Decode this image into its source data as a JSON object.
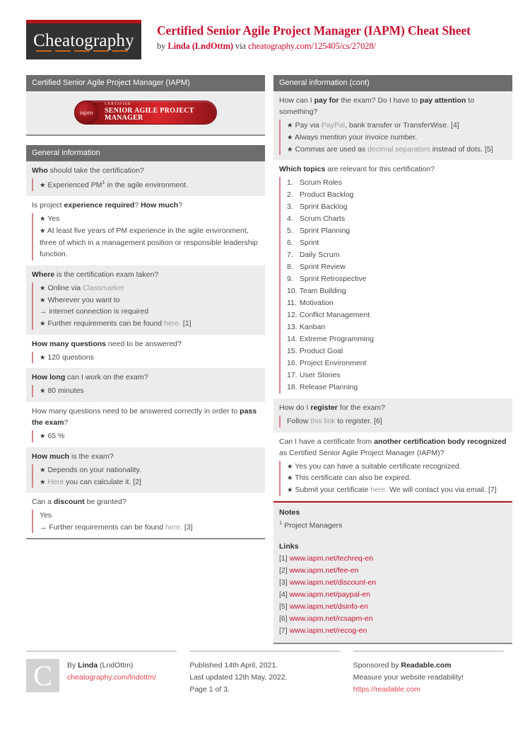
{
  "header": {
    "logo_text": "Cheatography",
    "title": "Certified Senior Agile Project Manager (IAPM) Cheat Sheet",
    "by_prefix": "by ",
    "author": "Linda (LndOttm)",
    "via": " via ",
    "source_url": "cheatography.com/125405/cs/27028/"
  },
  "left_column": {
    "badge_block": {
      "head": "Certified Senior Agile Project Manager (IAPM)",
      "badge": {
        "seal_text": "iapm",
        "small_line": "CERTIFIED",
        "large_line": "SENIOR AGILE PROJECT MANAGER"
      }
    },
    "general_info": {
      "head": "General information",
      "rows": [
        {
          "q_parts": [
            {
              "t": "Who",
              "b": true
            },
            {
              "t": " should take the certification?",
              "b": false
            }
          ],
          "answers": [
            {
              "marker": "star",
              "parts": [
                {
                  "t": "Experienced PM"
                },
                {
                  "t": "1",
                  "sup": true
                },
                {
                  "t": " in the agile environment."
                }
              ]
            }
          ]
        },
        {
          "q_parts": [
            {
              "t": "Is project ",
              "b": false
            },
            {
              "t": "experience required",
              "b": true
            },
            {
              "t": "? ",
              "b": false
            },
            {
              "t": "How much",
              "b": true
            },
            {
              "t": "?",
              "b": false
            }
          ],
          "answers": [
            {
              "marker": "star",
              "parts": [
                {
                  "t": "Yes"
                }
              ]
            },
            {
              "marker": "star",
              "parts": [
                {
                  "t": "At least five years of PM experience in the agile environment, three of which in a management position or responsible leadership function."
                }
              ]
            }
          ]
        },
        {
          "q_parts": [
            {
              "t": "Where",
              "b": true
            },
            {
              "t": " is the certification exam taken?",
              "b": false
            }
          ],
          "answers": [
            {
              "marker": "star",
              "parts": [
                {
                  "t": "Online via "
                },
                {
                  "t": "Classmarker",
                  "mut": true
                }
              ]
            },
            {
              "marker": "star",
              "parts": [
                {
                  "t": "Wherever you want to"
                }
              ]
            },
            {
              "marker": "arrow",
              "parts": [
                {
                  "t": "internet connection is required"
                }
              ]
            },
            {
              "marker": "star",
              "parts": [
                {
                  "t": "Further requirements can be found "
                },
                {
                  "t": "here.",
                  "mut": true
                },
                {
                  "t": " [1]"
                }
              ]
            }
          ]
        },
        {
          "q_parts": [
            {
              "t": "How many questions",
              "b": true
            },
            {
              "t": " need to be answered?",
              "b": false
            }
          ],
          "answers": [
            {
              "marker": "star",
              "parts": [
                {
                  "t": "120 questions"
                }
              ]
            }
          ]
        },
        {
          "q_parts": [
            {
              "t": "How long",
              "b": true
            },
            {
              "t": " can I work on the exam?",
              "b": false
            }
          ],
          "answers": [
            {
              "marker": "star",
              "parts": [
                {
                  "t": "80 minutes"
                }
              ]
            }
          ]
        },
        {
          "q_parts": [
            {
              "t": "How many questions need to be answered correctly in order to ",
              "b": false
            },
            {
              "t": "pass the exam",
              "b": true
            },
            {
              "t": "?",
              "b": false
            }
          ],
          "answers": [
            {
              "marker": "star",
              "parts": [
                {
                  "t": "65 %"
                }
              ]
            }
          ]
        },
        {
          "q_parts": [
            {
              "t": "How much",
              "b": true
            },
            {
              "t": " is the exam?",
              "b": false
            }
          ],
          "answers": [
            {
              "marker": "star",
              "parts": [
                {
                  "t": "Depends on your nationality."
                }
              ]
            },
            {
              "marker": "star",
              "parts": [
                {
                  "t": "Here",
                  "mut": true
                },
                {
                  "t": " you can calculate it. [2]"
                }
              ]
            }
          ]
        },
        {
          "q_parts": [
            {
              "t": "Can a ",
              "b": false
            },
            {
              "t": "discount",
              "b": true
            },
            {
              "t": " be granted?",
              "b": false
            }
          ],
          "answers": [
            {
              "marker": "none",
              "parts": [
                {
                  "t": "Yes"
                }
              ]
            },
            {
              "marker": "arrow",
              "parts": [
                {
                  "t": "Further requirements can be found "
                },
                {
                  "t": "here.",
                  "mut": true
                },
                {
                  "t": " [3]"
                }
              ]
            }
          ]
        }
      ]
    }
  },
  "right_column": {
    "general_info_cont": {
      "head": "General information (cont)",
      "rows": [
        {
          "q_parts": [
            {
              "t": "How can I ",
              "b": false
            },
            {
              "t": "pay for",
              "b": true
            },
            {
              "t": " the exam? Do I have to ",
              "b": false
            },
            {
              "t": "pay attention",
              "b": true
            },
            {
              "t": " to something?",
              "b": false
            }
          ],
          "answers": [
            {
              "marker": "star",
              "parts": [
                {
                  "t": "Pay via "
                },
                {
                  "t": "PayPal",
                  "mut": true
                },
                {
                  "t": ", bank transfer or TransferWise. [4]"
                }
              ]
            },
            {
              "marker": "star",
              "parts": [
                {
                  "t": "Always mention your invoice number."
                }
              ]
            },
            {
              "marker": "star",
              "parts": [
                {
                  "t": "Commas are used as "
                },
                {
                  "t": "decimal separators",
                  "mut": true
                },
                {
                  "t": " instead of dots. [5]"
                }
              ]
            }
          ]
        },
        {
          "q_parts": [
            {
              "t": "Which topics",
              "b": true
            },
            {
              "t": " are relevant for this certification?",
              "b": false
            }
          ],
          "numbered": [
            "Scrum Roles",
            "Product Backlog",
            "Sprint Backlog",
            "Scrum Charts",
            "Sprint Planning",
            "Sprint",
            "Daily Scrum",
            "Sprint Review",
            "Sprint Retrospective",
            "Team Building",
            "Motivation",
            "Conflict Management",
            "Kanban",
            "Extreme Programming",
            "Product Goal",
            "Project Environment",
            "User Stories",
            "Release Planning"
          ]
        },
        {
          "q_parts": [
            {
              "t": "How do I ",
              "b": false
            },
            {
              "t": "register",
              "b": true
            },
            {
              "t": " for the exam?",
              "b": false
            }
          ],
          "answers": [
            {
              "marker": "none",
              "parts": [
                {
                  "t": "Follow "
                },
                {
                  "t": "this link",
                  "mut": true
                },
                {
                  "t": " to register. [6]"
                }
              ]
            }
          ]
        },
        {
          "q_parts": [
            {
              "t": "Can I have a certificate from ",
              "b": false
            },
            {
              "t": "another certification body recognized",
              "b": true
            },
            {
              "t": " as Certified Senior Agile Project Manager (IAPM)?",
              "b": false
            }
          ],
          "answers": [
            {
              "marker": "star",
              "parts": [
                {
                  "t": "Yes you can have a suitable certificate recognized."
                }
              ]
            },
            {
              "marker": "star",
              "parts": [
                {
                  "t": "This certificate can also be expired."
                }
              ]
            },
            {
              "marker": "star",
              "parts": [
                {
                  "t": "Submit your certificate "
                },
                {
                  "t": "here.",
                  "mut": true
                },
                {
                  "t": " We will contact you via email. [7]"
                }
              ]
            }
          ]
        }
      ]
    },
    "notes": {
      "notes_head": "Notes",
      "notes_items": [
        {
          "sup": "1",
          "text": " Project Managers"
        }
      ],
      "links_head": "Links",
      "links": [
        {
          "num": "[1]",
          "url": "www.iapm.net/techreq-en"
        },
        {
          "num": "[2]",
          "url": "www.iapm.net/fee-en"
        },
        {
          "num": "[3]",
          "url": "www.iapm.net/discount-en"
        },
        {
          "num": "[4]",
          "url": "www.iapm.net/paypal-en"
        },
        {
          "num": "[5]",
          "url": "www.iapm.net/dsinfo-en"
        },
        {
          "num": "[6]",
          "url": "www.iapm.net/rcsapm-en"
        },
        {
          "num": "[7]",
          "url": "www.iapm.net/recog-en"
        }
      ]
    }
  },
  "footer": {
    "logo_letter": "C",
    "author_line_prefix": "By ",
    "author_name": "Linda",
    "author_handle": " (LndOttm)",
    "author_url": "cheatography.com/lndottm/",
    "published": "Published 14th April, 2021.",
    "updated": "Last updated 12th May, 2022.",
    "page": "Page 1 of 3.",
    "sponsor_prefix": "Sponsored by ",
    "sponsor_name": "Readable.com",
    "sponsor_tagline": "Measure your website readability!",
    "sponsor_url": "https://readable.com"
  }
}
